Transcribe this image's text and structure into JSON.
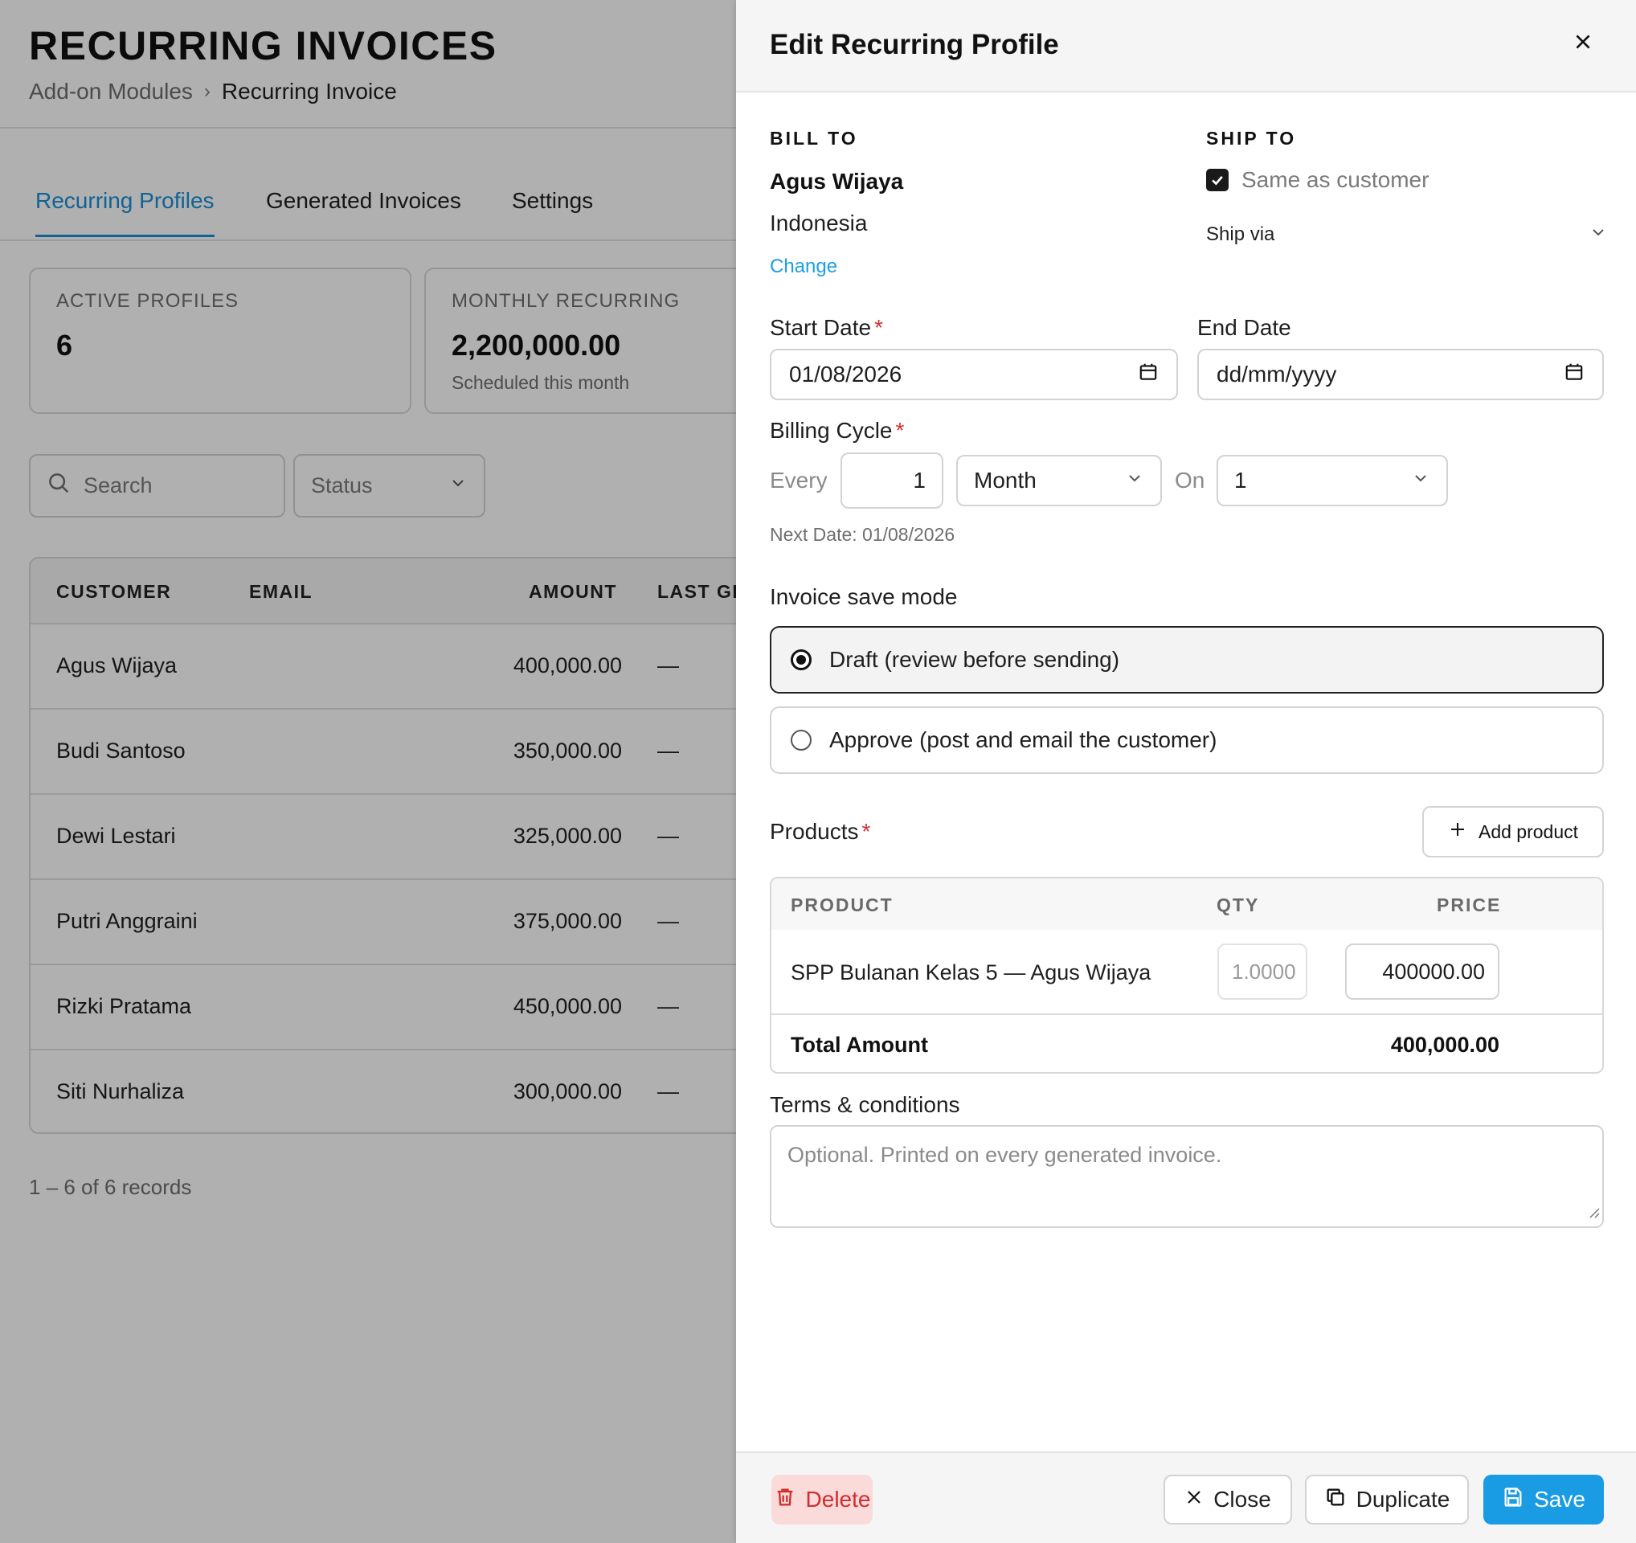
{
  "page": {
    "title": "RECURRING INVOICES",
    "breadcrumb": {
      "parent": "Add-on Modules",
      "separator": "›",
      "current": "Recurring Invoice"
    },
    "tabs": [
      {
        "label": "Recurring Profiles",
        "active": true
      },
      {
        "label": "Generated Invoices",
        "active": false
      },
      {
        "label": "Settings",
        "active": false
      }
    ],
    "stats": [
      {
        "label": "ACTIVE PROFILES",
        "value": "6",
        "sub": ""
      },
      {
        "label": "MONTHLY RECURRING",
        "value": "2,200,000.00",
        "sub": "Scheduled this month"
      }
    ],
    "search": {
      "placeholder": "Search",
      "icon": "search-icon"
    },
    "status_filter": {
      "label": "Status",
      "icon": "chevron-down-icon"
    },
    "table": {
      "columns": [
        "CUSTOMER",
        "EMAIL",
        "AMOUNT",
        "LAST GE"
      ],
      "rows": [
        {
          "customer": "Agus Wijaya",
          "email": "",
          "amount": "400,000.00",
          "last": "—"
        },
        {
          "customer": "Budi Santoso",
          "email": "",
          "amount": "350,000.00",
          "last": "—"
        },
        {
          "customer": "Dewi Lestari",
          "email": "",
          "amount": "325,000.00",
          "last": "—"
        },
        {
          "customer": "Putri Anggraini",
          "email": "",
          "amount": "375,000.00",
          "last": "—"
        },
        {
          "customer": "Rizki Pratama",
          "email": "",
          "amount": "450,000.00",
          "last": "—"
        },
        {
          "customer": "Siti Nurhaliza",
          "email": "",
          "amount": "300,000.00",
          "last": "—"
        }
      ]
    },
    "records": "1 – 6 of 6 records"
  },
  "drawer": {
    "title": "Edit Recurring Profile",
    "close_icon": "close-icon",
    "bill_to": {
      "label": "BILL TO",
      "name": "Agus Wijaya",
      "country": "Indonesia",
      "change_link": "Change"
    },
    "ship_to": {
      "label": "SHIP TO",
      "same_as_customer": "Same as customer",
      "checked": true,
      "ship_via": "Ship via"
    },
    "start_date": {
      "label": "Start Date",
      "required": "*",
      "value": "01/08/2026"
    },
    "end_date": {
      "label": "End Date",
      "placeholder": "dd/mm/yyyy"
    },
    "billing_cycle": {
      "label": "Billing Cycle",
      "required": "*",
      "every_label": "Every",
      "every_value": "1",
      "unit": "Month",
      "on_label": "On",
      "on_value": "1",
      "next_date": "Next Date: 01/08/2026"
    },
    "save_mode": {
      "label": "Invoice save mode",
      "options": [
        {
          "label": "Draft (review before sending)",
          "selected": true
        },
        {
          "label": "Approve (post and email the customer)",
          "selected": false
        }
      ]
    },
    "products": {
      "label": "Products",
      "required": "*",
      "add_button": "Add product",
      "columns": {
        "product": "PRODUCT",
        "qty": "QTY",
        "price": "PRICE"
      },
      "items": [
        {
          "name": "SPP Bulanan Kelas 5 — Agus Wijaya",
          "qty": "1.0000",
          "price": "400000.00"
        }
      ],
      "total_label": "Total Amount",
      "total_value": "400,000.00"
    },
    "terms": {
      "label": "Terms & conditions",
      "placeholder": "Optional. Printed on every generated invoice."
    },
    "footer": {
      "delete": "Delete",
      "close": "Close",
      "duplicate": "Duplicate",
      "save": "Save"
    }
  },
  "colors": {
    "accent": "#1890d8",
    "save": "#1a9ce4",
    "danger": "#d12d2d",
    "required": "#d32f2f"
  }
}
